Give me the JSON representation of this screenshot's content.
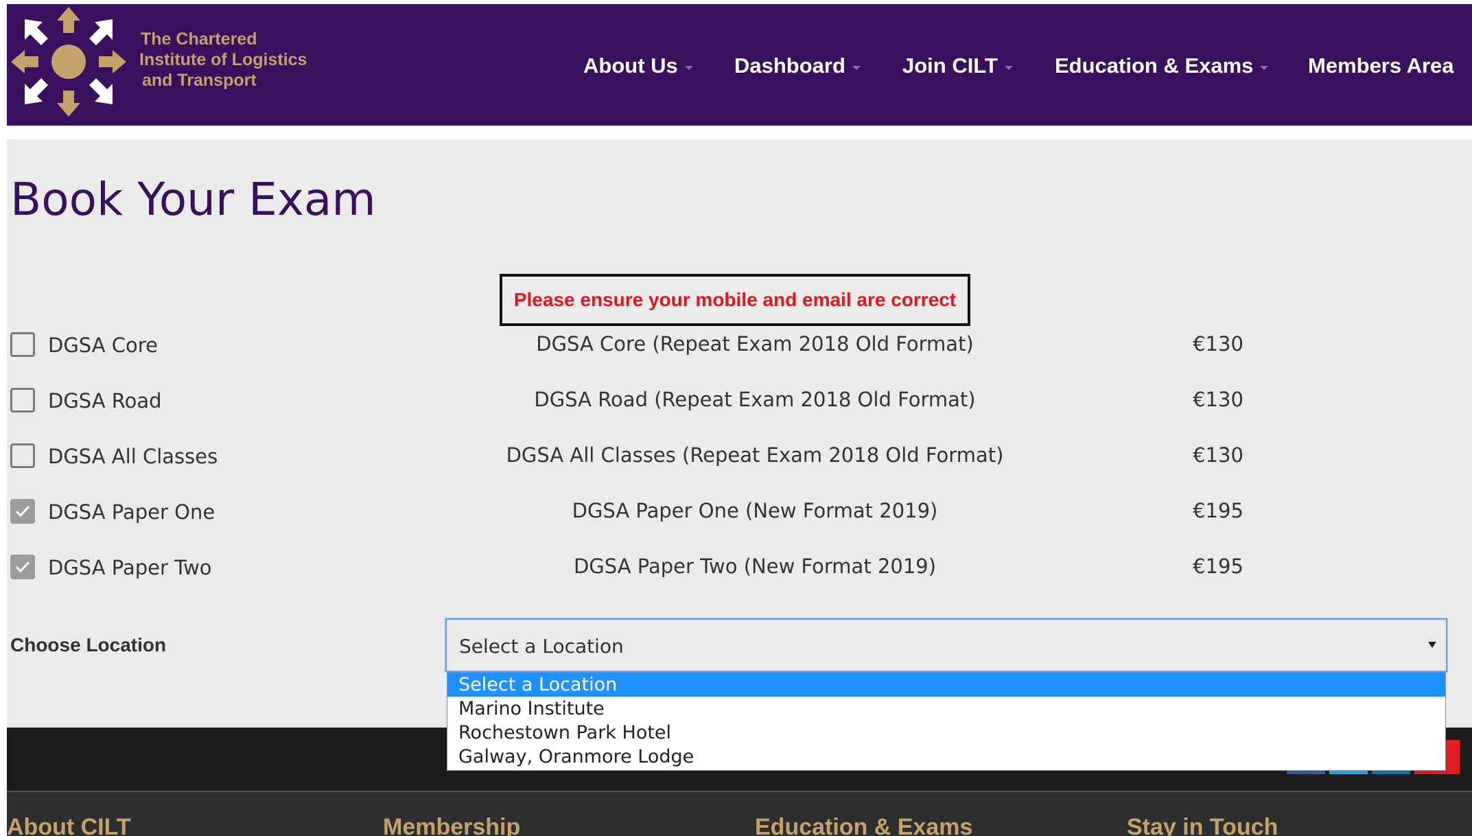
{
  "header": {
    "org_name_lines": [
      "The Chartered",
      "Institute of Logistics",
      "and Transport"
    ],
    "nav": [
      {
        "label": "About Us",
        "has_dropdown": true
      },
      {
        "label": "Dashboard",
        "has_dropdown": true
      },
      {
        "label": "Join CILT",
        "has_dropdown": true
      },
      {
        "label": "Education & Exams",
        "has_dropdown": true
      },
      {
        "label": "Members Area",
        "has_dropdown": false
      }
    ]
  },
  "page": {
    "title": "Book Your Exam",
    "notice": "Please ensure your mobile and email are correct"
  },
  "exams": [
    {
      "name": "DGSA Core",
      "description": "DGSA Core (Repeat Exam 2018 Old Format)",
      "price": "€130",
      "checked": false
    },
    {
      "name": "DGSA Road",
      "description": "DGSA Road (Repeat Exam 2018 Old Format)",
      "price": "€130",
      "checked": false
    },
    {
      "name": "DGSA All Classes",
      "description": "DGSA All Classes (Repeat Exam 2018 Old Format)",
      "price": "€130",
      "checked": false
    },
    {
      "name": "DGSA Paper One",
      "description": "DGSA Paper One (New Format 2019)",
      "price": "€195",
      "checked": true
    },
    {
      "name": "DGSA Paper Two",
      "description": "DGSA Paper Two (New Format 2019)",
      "price": "€195",
      "checked": true
    }
  ],
  "location": {
    "label": "Choose Location",
    "selected": "Select a Location",
    "options": [
      "Select a Location",
      "Marino Institute",
      "Rochestown Park Hotel",
      "Galway, Oranmore Lodge"
    ],
    "highlighted_index": 0
  },
  "footer": {
    "headings": [
      "About CILT",
      "Membership",
      "Education & Exams",
      "Stay in Touch"
    ]
  },
  "colors": {
    "brand_purple": "#38105d",
    "brand_gold": "#c5a26a",
    "notice_red": "#e8141b",
    "option_highlight": "#1e90ff"
  }
}
